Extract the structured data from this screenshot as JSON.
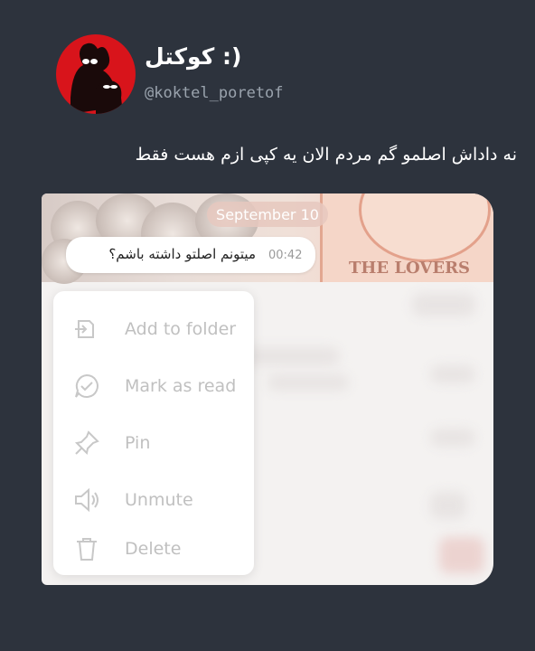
{
  "post": {
    "display_name": "کوکتل :)",
    "handle": "@koktel_poretof",
    "text": "نه داداش اصلمو گم مردم الان یه کپی ازم هست فقط"
  },
  "screenshot": {
    "date_chip": "September 10",
    "message": {
      "text": "میتونم اصلتو داشته باشم؟",
      "time": "00:42"
    },
    "wallpaper_label": "THE LOVERS",
    "menu": {
      "items": [
        {
          "label": "Add to folder",
          "icon": "folder-add-icon"
        },
        {
          "label": "Mark as read",
          "icon": "chat-check-icon"
        },
        {
          "label": "Pin",
          "icon": "pin-icon"
        },
        {
          "label": "Unmute",
          "icon": "speaker-icon"
        },
        {
          "label": "Delete",
          "icon": "trash-icon"
        }
      ]
    }
  },
  "colors": {
    "background": "#2d333d",
    "avatar": "#d8141b",
    "menu_text": "#c0c0c0"
  }
}
